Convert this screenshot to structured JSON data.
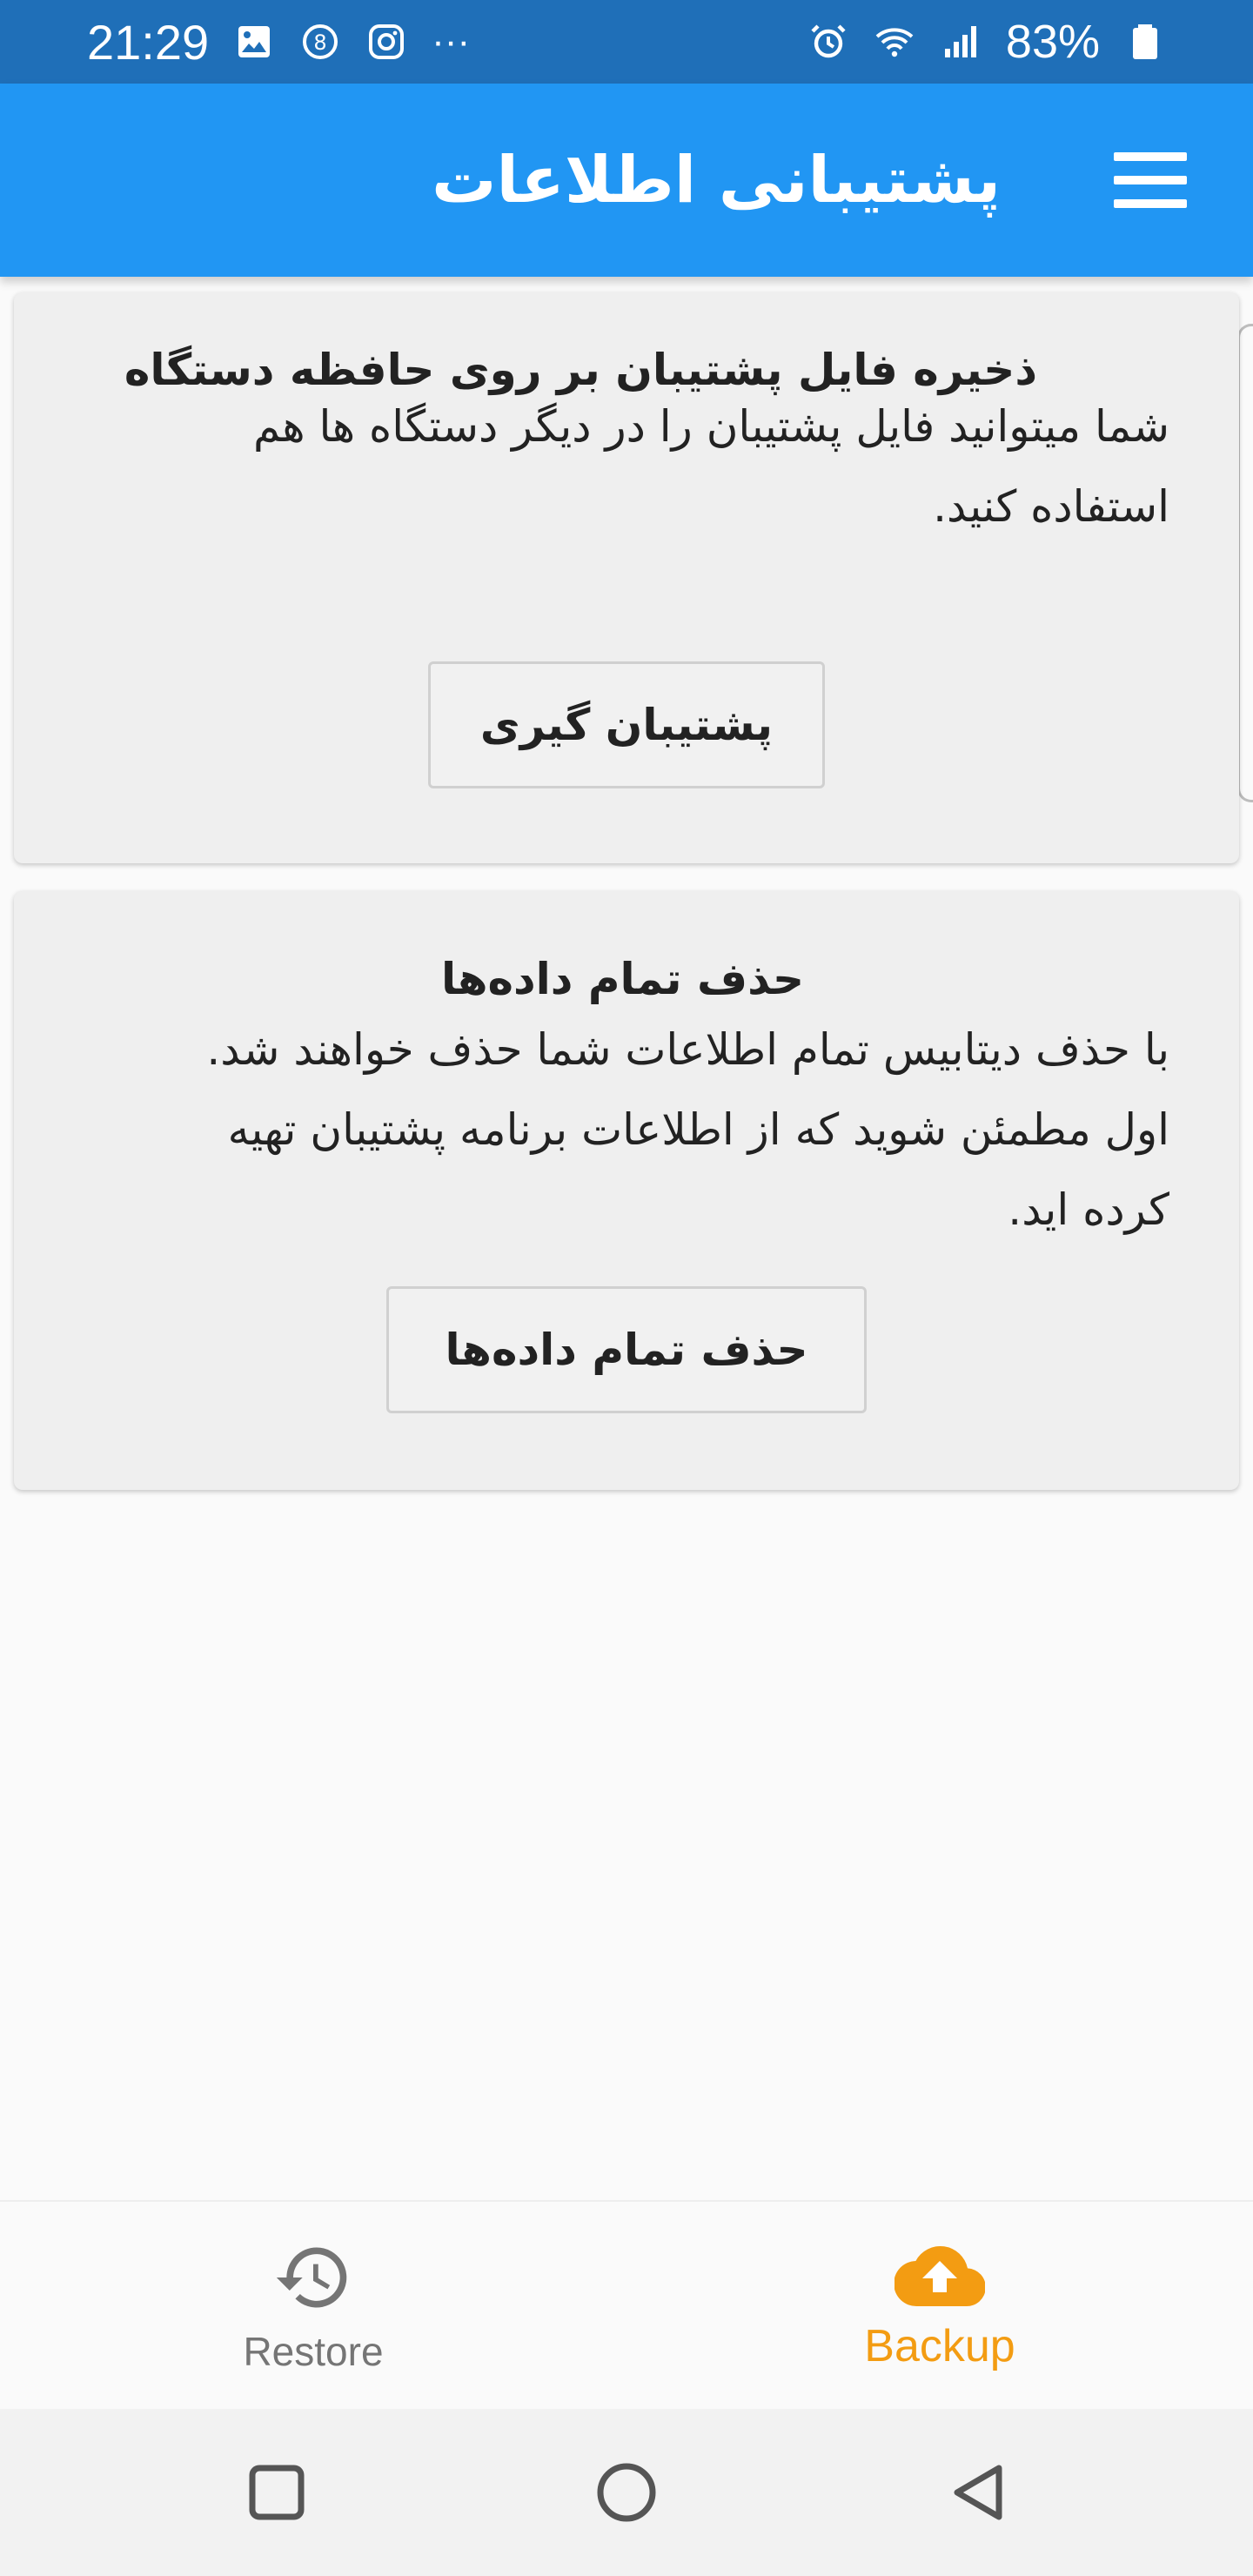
{
  "status_bar": {
    "time": "21:29",
    "more": "···",
    "battery": "83%"
  },
  "app_bar": {
    "title": "پشتیبانی اطلاعات"
  },
  "cards": [
    {
      "title": "ذخیره فایل پشتیبان بر روی حافظه دستگاه",
      "body": "شما میتوانید فایل پشتیبان را در دیگر دستگاه ها هم استفاده کنید.",
      "button": "پشتیبان گیری"
    },
    {
      "title": "حذف تمام داده‌ها",
      "body": "با حذف دیتابیس تمام اطلاعات شما  حذف خواهند شد. اول مطمئن شوید که از اطلاعات برنامه پشتیبان تهیه کرده اید.",
      "button": "حذف تمام داده‌ها"
    }
  ],
  "bottom_nav": {
    "items": [
      {
        "label": "Restore",
        "icon": "history-icon",
        "active": false
      },
      {
        "label": "Backup",
        "icon": "cloud-upload-icon",
        "active": true
      }
    ]
  },
  "colors": {
    "status_bar": "#1f6fb8",
    "app_bar": "#2196f3",
    "active_tab": "#f39c12",
    "inactive_tab": "#757575"
  }
}
